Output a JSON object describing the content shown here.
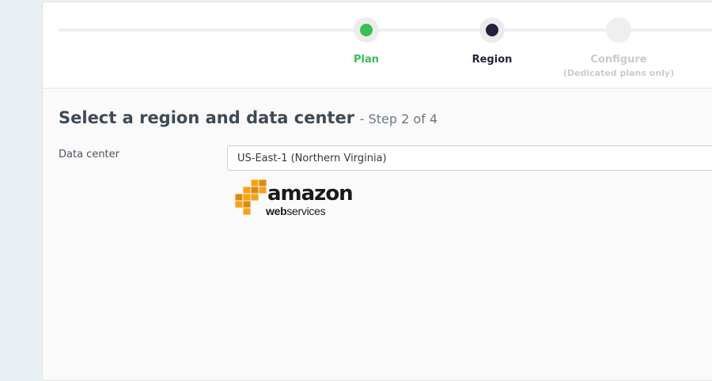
{
  "stepper": {
    "steps": [
      {
        "label": "Plan",
        "state": "complete",
        "color": "#3bbf54"
      },
      {
        "label": "Region",
        "state": "active",
        "color": "#22223f"
      },
      {
        "label": "Configure",
        "sublabel": "(Dedicated plans only)",
        "state": "upcoming",
        "color": "#c8cccf"
      }
    ]
  },
  "main": {
    "heading": "Select a region and data center",
    "step_count": "- Step 2 of 4"
  },
  "form": {
    "data_center_label": "Data center",
    "data_center_value": "US-East-1 (Northern Virginia)"
  },
  "provider_logo": {
    "line1": "amazon",
    "line2_web": "web",
    "line2_services": "services",
    "brand_color": "#f7a11a"
  }
}
